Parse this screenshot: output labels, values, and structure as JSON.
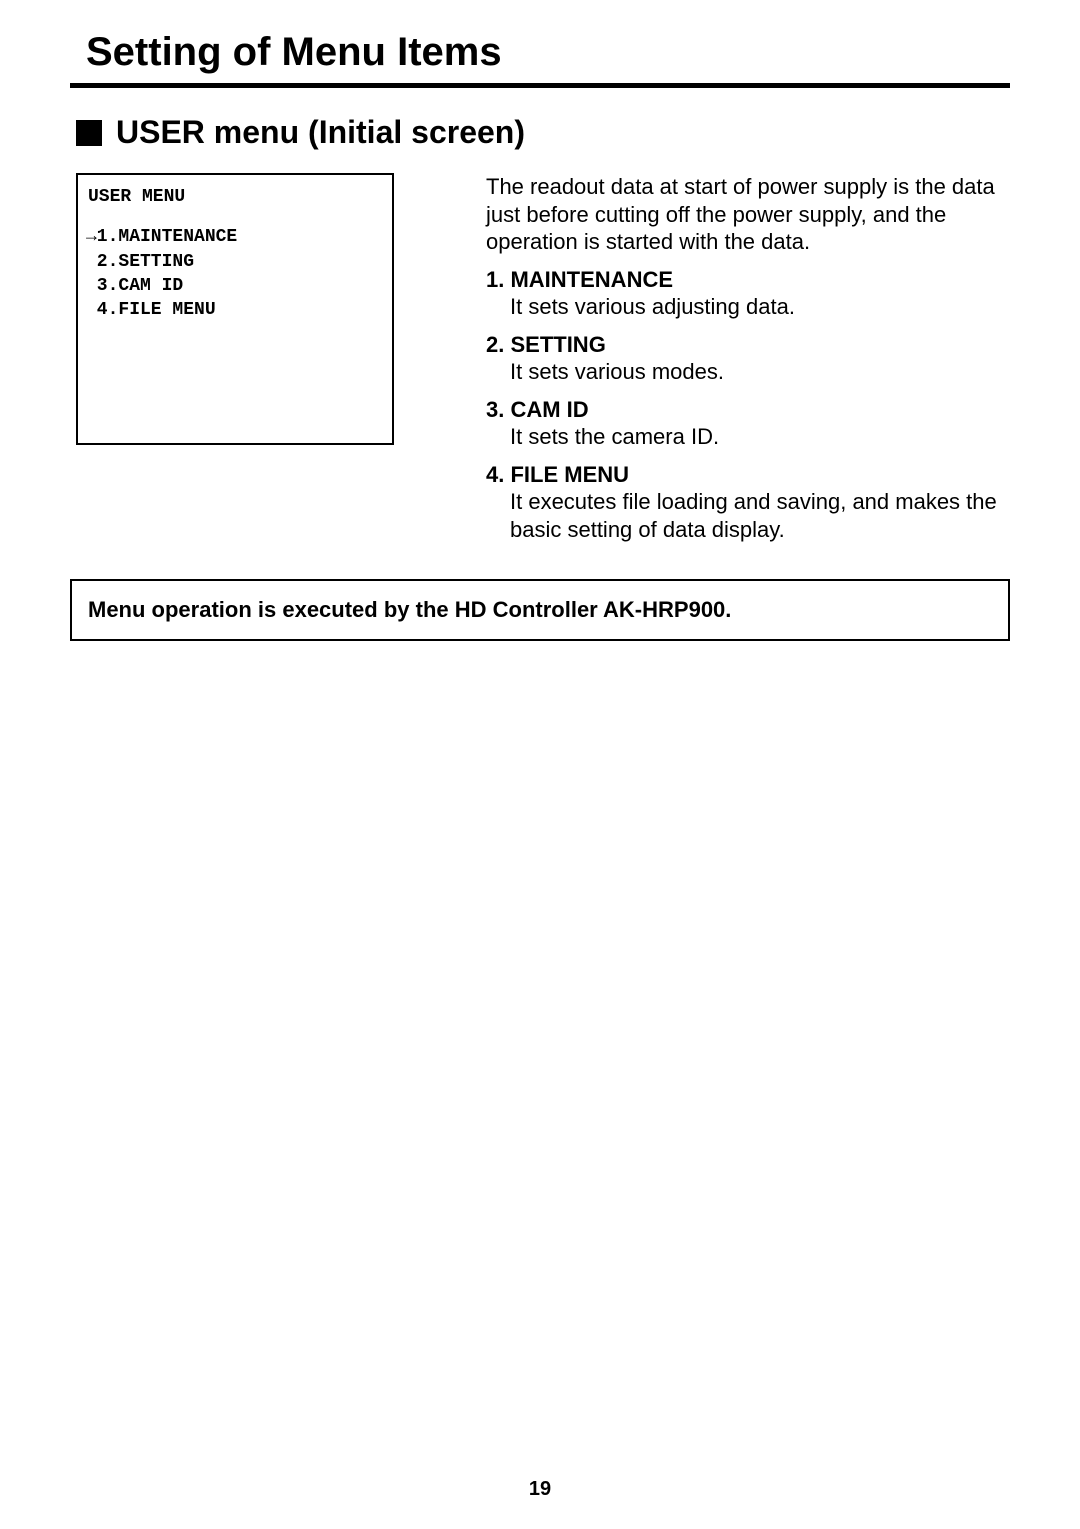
{
  "page": {
    "title": "Setting of Menu Items",
    "subsection_title": "USER menu (Initial screen)",
    "page_number": "19"
  },
  "menu_box": {
    "title": "USER MENU",
    "cursor": "→",
    "items": [
      {
        "num": "1",
        "label": "MAINTENANCE",
        "selected": true
      },
      {
        "num": "2",
        "label": "SETTING",
        "selected": false
      },
      {
        "num": "3",
        "label": "CAM ID",
        "selected": false
      },
      {
        "num": "4",
        "label": "FILE MENU",
        "selected": false
      }
    ]
  },
  "intro_text": "The readout data at start of power supply is the data just before cutting off the power supply, and the operation is started with the data.",
  "descriptions": [
    {
      "num": "1.",
      "title": "MAINTENANCE",
      "desc": "It sets various adjusting data."
    },
    {
      "num": "2.",
      "title": "SETTING",
      "desc": "It sets various modes."
    },
    {
      "num": "3.",
      "title": "CAM ID",
      "desc": "It sets the camera ID."
    },
    {
      "num": "4.",
      "title": "FILE MENU",
      "desc": "It executes file loading and saving, and makes the basic setting of data display."
    }
  ],
  "note": "Menu operation is executed by the HD Controller AK-HRP900."
}
